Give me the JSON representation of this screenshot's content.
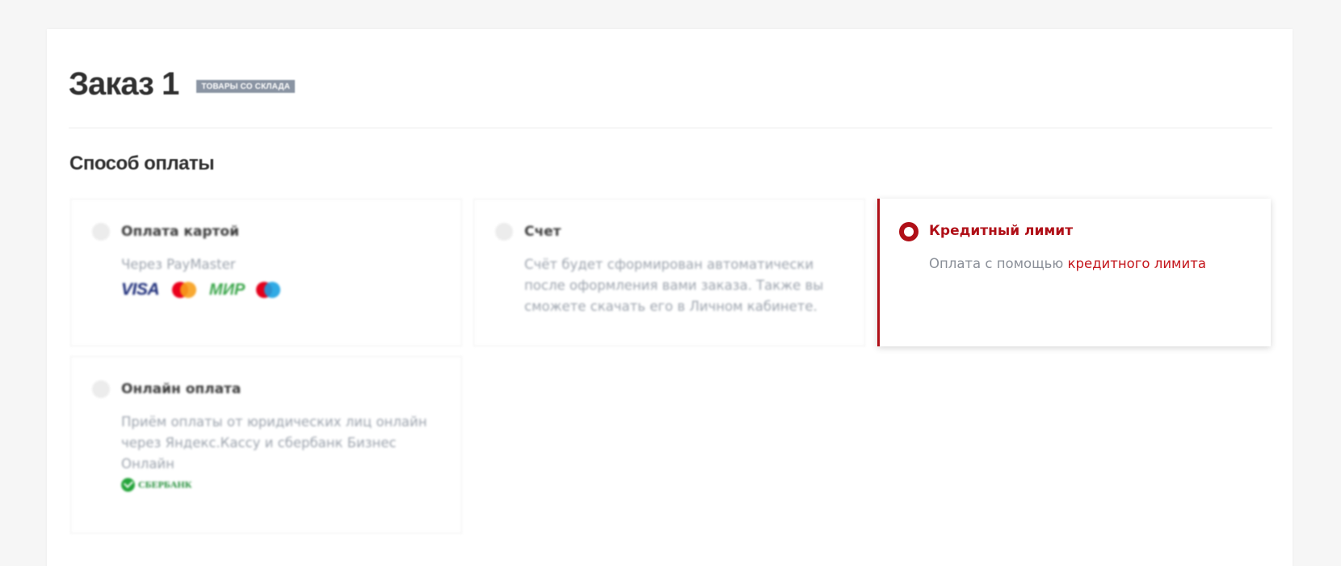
{
  "order": {
    "title": "Заказ 1",
    "badge": "Товары со склада"
  },
  "payment": {
    "section_title": "Способ оплаты",
    "options": [
      {
        "title": "Оплата картой",
        "description": "Через PayMaster",
        "selected": false,
        "logos": [
          "VISA",
          "mastercard-icon",
          "МИР",
          "maestro-icon"
        ]
      },
      {
        "title": "Счет",
        "description": "Счёт будет сформирован автоматически после оформления вами заказа. Также вы сможете скачать его в Личном кабинете.",
        "selected": false
      },
      {
        "title": "Кредитный лимит",
        "description_prefix": "Оплата с помощью ",
        "description_link": "кредитного лимита",
        "selected": true
      },
      {
        "title": "Онлайн оплата",
        "description": "Приём оплаты от юридических лиц онлайн через Яндекс.Кассу и сбербанк Бизнес Онлайн",
        "selected": false,
        "logos": [
          "СБЕРБАНК"
        ]
      }
    ]
  },
  "colors": {
    "accent": "#b01018",
    "link": "#c4161c",
    "badge_bg": "#8a94a3",
    "muted_text": "#9ca3ad"
  }
}
